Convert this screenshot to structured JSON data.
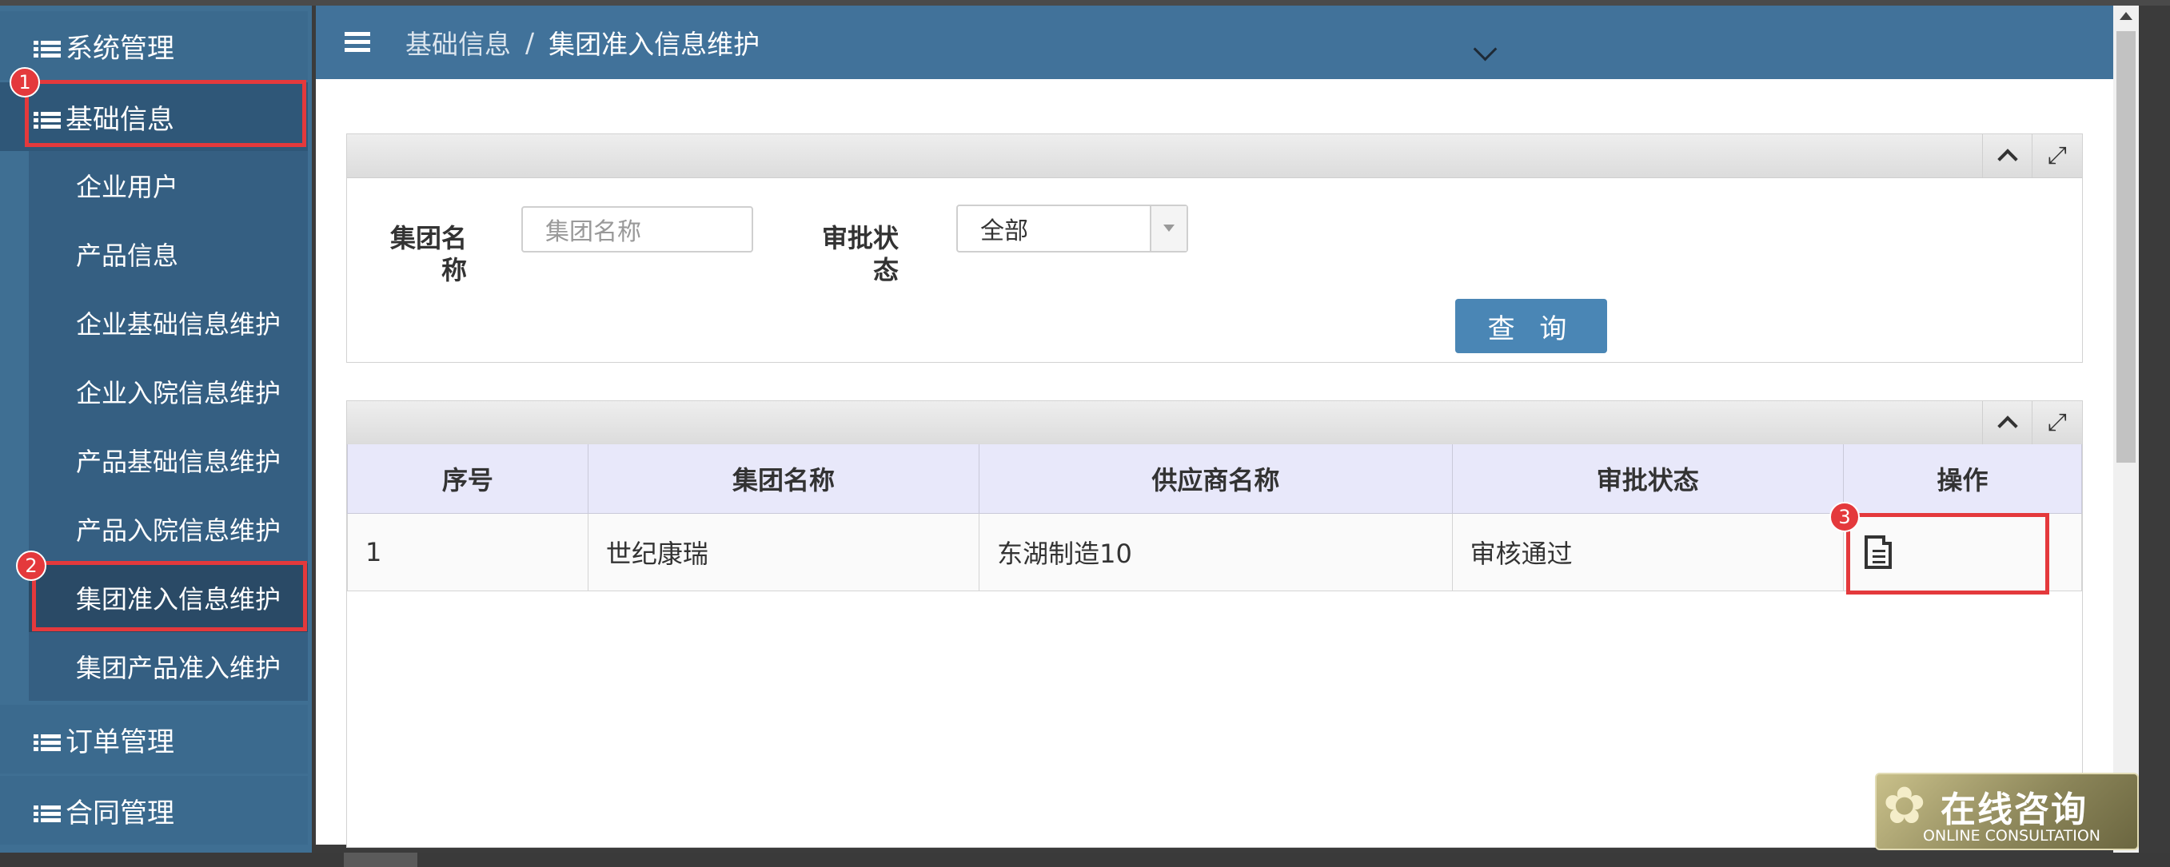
{
  "sidebar": {
    "groups": {
      "system": "系统管理",
      "basic": "基础信息",
      "orders": "订单管理",
      "contracts": "合同管理"
    },
    "items": [
      "企业用户",
      "产品信息",
      "企业基础信息维护",
      "企业入院信息维护",
      "产品基础信息维护",
      "产品入院信息维护",
      "集团准入信息维护",
      "集团产品准入维护"
    ],
    "selected_index": 6
  },
  "annotations": [
    "1",
    "2",
    "3"
  ],
  "header": {
    "breadcrumb_root": "基础信息",
    "breadcrumb_sep": "/",
    "breadcrumb_current": "集团准入信息维护"
  },
  "search": {
    "group_name_label_line1": "集团名",
    "group_name_label_line2": "称",
    "group_name_placeholder": "集团名称",
    "status_label_line1": "审批状",
    "status_label_line2": "态",
    "status_value": "全部",
    "query_button": "查 询"
  },
  "table": {
    "headers": [
      "序号",
      "集团名称",
      "供应商名称",
      "审批状态",
      "操作"
    ],
    "rows": [
      {
        "no": "1",
        "group": "世纪康瑞",
        "supplier": "东湖制造10",
        "status": "审核通过"
      }
    ]
  },
  "consult": {
    "title": "在线咨询",
    "subtitle": "ONLINE CONSULTATION"
  },
  "colors": {
    "sidebar": "#3f6f93",
    "header": "#41729a",
    "query_button": "#4a86b5",
    "highlight": "#e4393c"
  }
}
